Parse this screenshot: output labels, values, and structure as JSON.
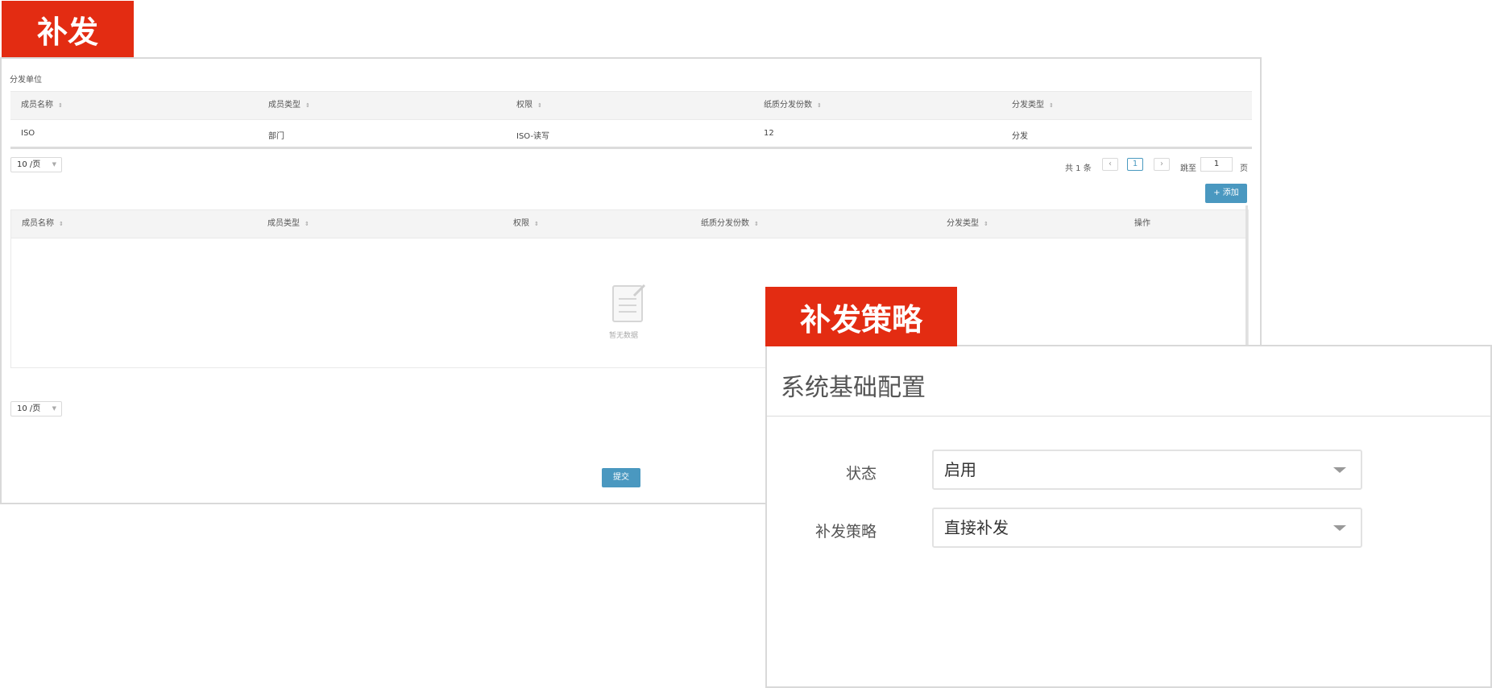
{
  "tags": {
    "reissue": "补发",
    "strategy": "补发策略"
  },
  "section1": {
    "title": "分发单位",
    "columns": [
      "成员名称",
      "成员类型",
      "权限",
      "纸质分发份数",
      "分发类型"
    ],
    "rows": [
      {
        "name": "ISO",
        "type": "部门",
        "perm": "ISO-读写",
        "copies": "12",
        "dist": "分发"
      }
    ],
    "pagesize": "10 /页",
    "total": "共 1 条",
    "current_page": "1",
    "jump_label": "跳至",
    "jump_value": "1",
    "page_suffix": "页"
  },
  "section2": {
    "add_button": "+ 添加",
    "columns": [
      "成员名称",
      "成员类型",
      "权限",
      "纸质分发份数",
      "分发类型",
      "操作"
    ],
    "empty_text": "暂无数据",
    "pagesize": "10 /页"
  },
  "submit_button": "提交",
  "strategy": {
    "title": "系统基础配置",
    "fields": [
      {
        "label": "状态",
        "value": "启用"
      },
      {
        "label": "补发策略",
        "value": "直接补发"
      }
    ]
  }
}
